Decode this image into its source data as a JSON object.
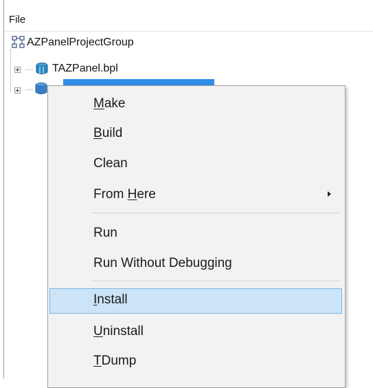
{
  "header": {
    "title": "File"
  },
  "tree": {
    "group": {
      "label": "AZPanelProjectGroup",
      "icon": "project-group-icon"
    },
    "project1": {
      "label": "TAZPanel.bpl",
      "icon": "package-icon"
    },
    "project2": {
      "label": "",
      "icon": "package-icon"
    }
  },
  "menu": {
    "make": {
      "pre": "",
      "key": "M",
      "post": "ake"
    },
    "build": {
      "pre": "",
      "key": "B",
      "post": "uild"
    },
    "clean": {
      "pre": "Clean",
      "key": "",
      "post": ""
    },
    "from_here": {
      "pre": "From ",
      "key": "H",
      "post": "ere"
    },
    "run": {
      "pre": "Run",
      "key": "",
      "post": ""
    },
    "run_without": {
      "pre": "Run Without Debu",
      "key": "g",
      "post": "ging"
    },
    "install": {
      "pre": "",
      "key": "I",
      "post": "nstall"
    },
    "uninstall": {
      "pre": "",
      "key": "U",
      "post": "ninstall"
    },
    "tdump": {
      "pre": "",
      "key": "T",
      "post": "Dump"
    }
  },
  "colors": {
    "selection": "#2f8ee8",
    "menu_bg": "#f2f2f2",
    "highlight_bg": "#cce4f7",
    "highlight_border": "#7fb5e3"
  }
}
